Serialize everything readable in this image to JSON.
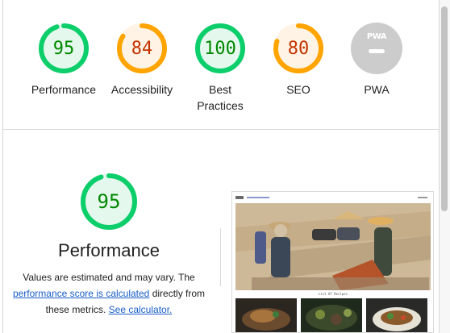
{
  "categories": [
    {
      "label": "Performance",
      "score": "95",
      "score_fraction": 0.95,
      "status": "pass",
      "color": "#0cce6b",
      "text_color": "#008800",
      "fill": "#e5f8ed"
    },
    {
      "label": "Accessibility",
      "score": "84",
      "score_fraction": 0.84,
      "status": "average",
      "color": "#ffa400",
      "text_color": "#c33300",
      "fill": "#fff3e5"
    },
    {
      "label_line1": "Best",
      "label_line2": "Practices",
      "score": "100",
      "score_fraction": 1.0,
      "status": "pass",
      "color": "#0cce6b",
      "text_color": "#008800",
      "fill": "#e5f8ed"
    },
    {
      "label": "SEO",
      "score": "80",
      "score_fraction": 0.8,
      "status": "average",
      "color": "#ffa400",
      "text_color": "#c33300",
      "fill": "#fff3e5"
    },
    {
      "label": "PWA",
      "badge_text": "PWA",
      "status": "not-applicable",
      "icon": "pwa-badge-icon",
      "color": "#cccccc"
    }
  ],
  "performance_section": {
    "score": "95",
    "score_fraction": 0.95,
    "title": "Performance",
    "desc_part1": "Values are estimated and may vary. The ",
    "link_score": "performance score is calculated",
    "desc_part2": " directly from these metrics. ",
    "link_calculator": "See calculator."
  },
  "screenshot": {
    "caption": "List Of Recipes",
    "alt": "page-screenshot-thumbnail"
  }
}
